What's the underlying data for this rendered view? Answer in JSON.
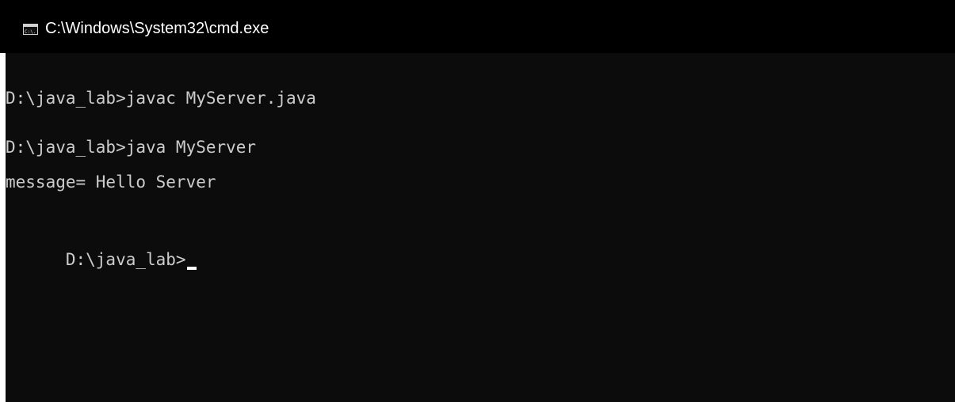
{
  "window": {
    "title": "C:\\Windows\\System32\\cmd.exe",
    "icon": "console-window-icon"
  },
  "console": {
    "lines": [
      "D:\\java_lab>javac MyServer.java",
      "",
      "D:\\java_lab>java MyServer",
      "message= Hello Server",
      "",
      "D:\\java_lab>"
    ]
  },
  "colors": {
    "titlebar_bg": "#000000",
    "console_bg": "#0c0c0c",
    "console_text": "#cccccc",
    "cursor": "#ffffff"
  }
}
